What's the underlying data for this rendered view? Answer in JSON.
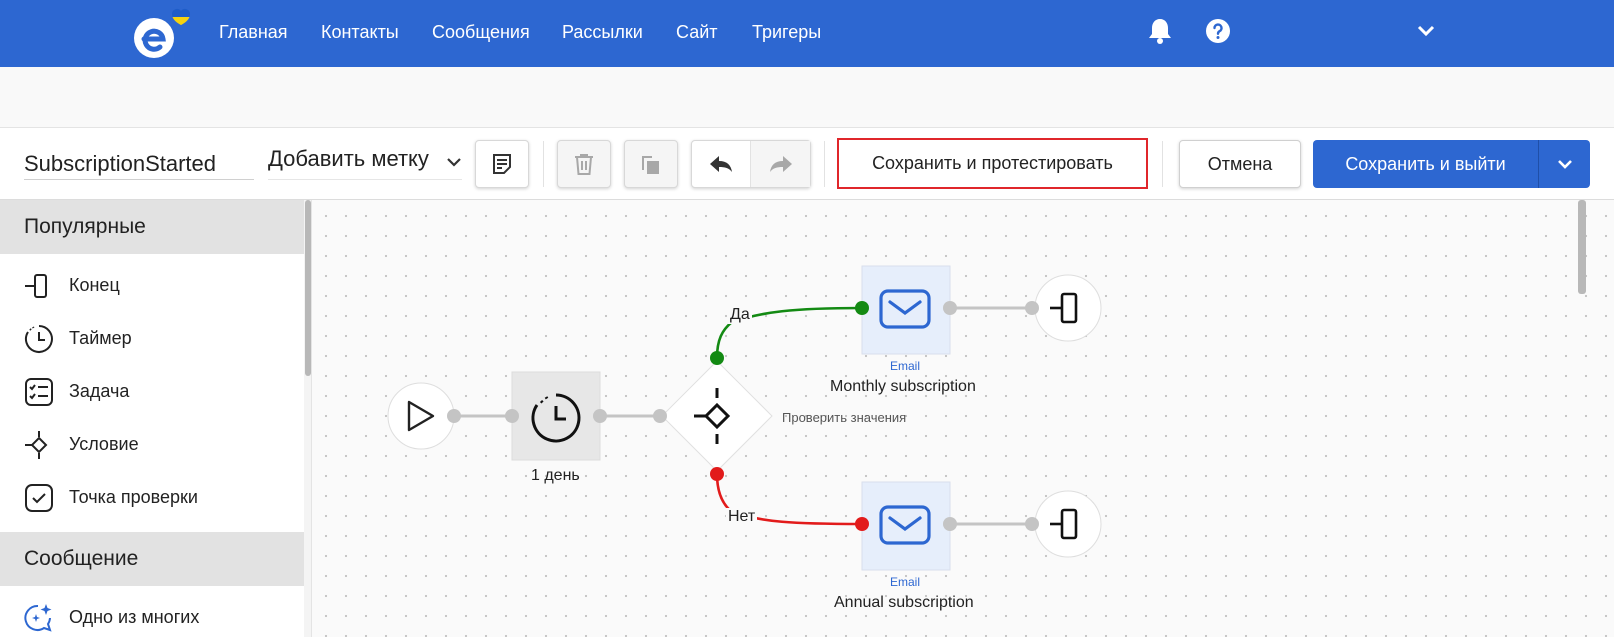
{
  "nav": {
    "items": [
      "Главная",
      "Контакты",
      "Сообщения",
      "Рассылки",
      "Сайт",
      "Тригеры"
    ],
    "colors": {
      "bar": "#2d67d1",
      "heart_top": "#1e5cc8",
      "heart_bottom": "#f5d20f"
    }
  },
  "toolbar": {
    "name_value": "SubscriptionStarted",
    "tag_label": "Добавить метку",
    "test_label": "Сохранить и протестировать",
    "cancel_label": "Отмена",
    "save_label": "Сохранить и выйти",
    "highlight_color": "#e0262b"
  },
  "sidebar": {
    "cat_popular": "Популярные",
    "cat_message": "Сообщение",
    "items": [
      "Конец",
      "Таймер",
      "Задача",
      "Условие",
      "Точка проверки",
      "Одно из многих"
    ]
  },
  "flow": {
    "timer_label": "1 день",
    "condition_label": "Проверить значения",
    "yes_label": "Да",
    "no_label": "Нет",
    "email_type": "Email",
    "email_top_label": "Monthly subscription",
    "email_bottom_label": "Annual subscription",
    "colors": {
      "yes": "#138a13",
      "no": "#e21b1b",
      "connector": "#c4c4c4",
      "email_icon": "#2d67d1"
    }
  }
}
